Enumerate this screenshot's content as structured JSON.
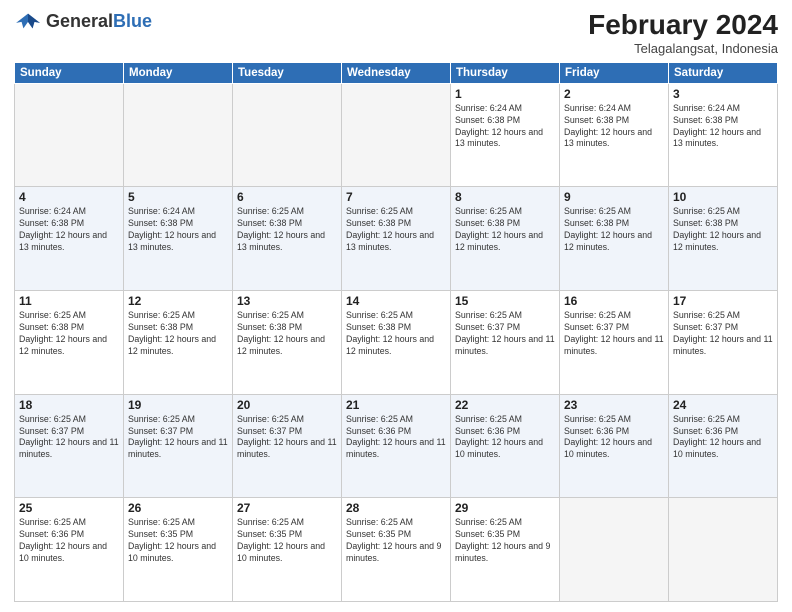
{
  "header": {
    "logo_general": "General",
    "logo_blue": "Blue",
    "month_year": "February 2024",
    "location": "Telagalangsat, Indonesia"
  },
  "weekdays": [
    "Sunday",
    "Monday",
    "Tuesday",
    "Wednesday",
    "Thursday",
    "Friday",
    "Saturday"
  ],
  "weeks": [
    [
      {
        "day": "",
        "empty": true
      },
      {
        "day": "",
        "empty": true
      },
      {
        "day": "",
        "empty": true
      },
      {
        "day": "",
        "empty": true
      },
      {
        "day": "1",
        "sunrise": "6:24 AM",
        "sunset": "6:38 PM",
        "daylight": "12 hours and 13 minutes."
      },
      {
        "day": "2",
        "sunrise": "6:24 AM",
        "sunset": "6:38 PM",
        "daylight": "12 hours and 13 minutes."
      },
      {
        "day": "3",
        "sunrise": "6:24 AM",
        "sunset": "6:38 PM",
        "daylight": "12 hours and 13 minutes."
      }
    ],
    [
      {
        "day": "4",
        "sunrise": "6:24 AM",
        "sunset": "6:38 PM",
        "daylight": "12 hours and 13 minutes."
      },
      {
        "day": "5",
        "sunrise": "6:24 AM",
        "sunset": "6:38 PM",
        "daylight": "12 hours and 13 minutes."
      },
      {
        "day": "6",
        "sunrise": "6:25 AM",
        "sunset": "6:38 PM",
        "daylight": "12 hours and 13 minutes."
      },
      {
        "day": "7",
        "sunrise": "6:25 AM",
        "sunset": "6:38 PM",
        "daylight": "12 hours and 13 minutes."
      },
      {
        "day": "8",
        "sunrise": "6:25 AM",
        "sunset": "6:38 PM",
        "daylight": "12 hours and 12 minutes."
      },
      {
        "day": "9",
        "sunrise": "6:25 AM",
        "sunset": "6:38 PM",
        "daylight": "12 hours and 12 minutes."
      },
      {
        "day": "10",
        "sunrise": "6:25 AM",
        "sunset": "6:38 PM",
        "daylight": "12 hours and 12 minutes."
      }
    ],
    [
      {
        "day": "11",
        "sunrise": "6:25 AM",
        "sunset": "6:38 PM",
        "daylight": "12 hours and 12 minutes."
      },
      {
        "day": "12",
        "sunrise": "6:25 AM",
        "sunset": "6:38 PM",
        "daylight": "12 hours and 12 minutes."
      },
      {
        "day": "13",
        "sunrise": "6:25 AM",
        "sunset": "6:38 PM",
        "daylight": "12 hours and 12 minutes."
      },
      {
        "day": "14",
        "sunrise": "6:25 AM",
        "sunset": "6:38 PM",
        "daylight": "12 hours and 12 minutes."
      },
      {
        "day": "15",
        "sunrise": "6:25 AM",
        "sunset": "6:37 PM",
        "daylight": "12 hours and 11 minutes."
      },
      {
        "day": "16",
        "sunrise": "6:25 AM",
        "sunset": "6:37 PM",
        "daylight": "12 hours and 11 minutes."
      },
      {
        "day": "17",
        "sunrise": "6:25 AM",
        "sunset": "6:37 PM",
        "daylight": "12 hours and 11 minutes."
      }
    ],
    [
      {
        "day": "18",
        "sunrise": "6:25 AM",
        "sunset": "6:37 PM",
        "daylight": "12 hours and 11 minutes."
      },
      {
        "day": "19",
        "sunrise": "6:25 AM",
        "sunset": "6:37 PM",
        "daylight": "12 hours and 11 minutes."
      },
      {
        "day": "20",
        "sunrise": "6:25 AM",
        "sunset": "6:37 PM",
        "daylight": "12 hours and 11 minutes."
      },
      {
        "day": "21",
        "sunrise": "6:25 AM",
        "sunset": "6:36 PM",
        "daylight": "12 hours and 11 minutes."
      },
      {
        "day": "22",
        "sunrise": "6:25 AM",
        "sunset": "6:36 PM",
        "daylight": "12 hours and 10 minutes."
      },
      {
        "day": "23",
        "sunrise": "6:25 AM",
        "sunset": "6:36 PM",
        "daylight": "12 hours and 10 minutes."
      },
      {
        "day": "24",
        "sunrise": "6:25 AM",
        "sunset": "6:36 PM",
        "daylight": "12 hours and 10 minutes."
      }
    ],
    [
      {
        "day": "25",
        "sunrise": "6:25 AM",
        "sunset": "6:36 PM",
        "daylight": "12 hours and 10 minutes."
      },
      {
        "day": "26",
        "sunrise": "6:25 AM",
        "sunset": "6:35 PM",
        "daylight": "12 hours and 10 minutes."
      },
      {
        "day": "27",
        "sunrise": "6:25 AM",
        "sunset": "6:35 PM",
        "daylight": "12 hours and 10 minutes."
      },
      {
        "day": "28",
        "sunrise": "6:25 AM",
        "sunset": "6:35 PM",
        "daylight": "12 hours and 9 minutes."
      },
      {
        "day": "29",
        "sunrise": "6:25 AM",
        "sunset": "6:35 PM",
        "daylight": "12 hours and 9 minutes."
      },
      {
        "day": "",
        "empty": true
      },
      {
        "day": "",
        "empty": true
      }
    ]
  ]
}
